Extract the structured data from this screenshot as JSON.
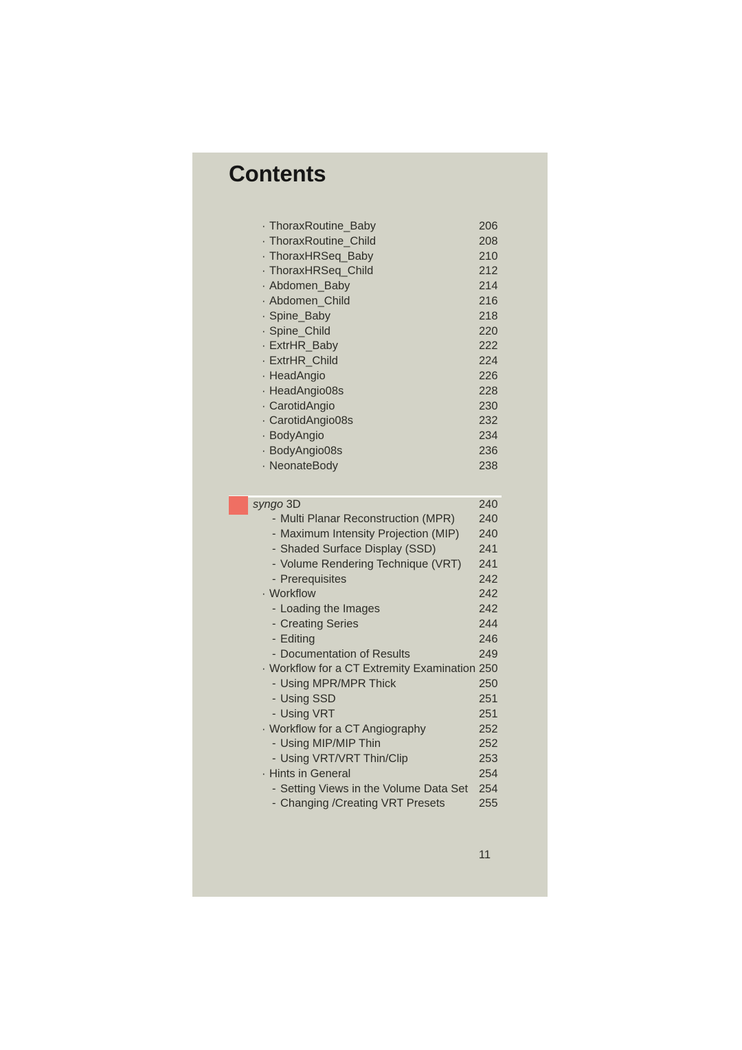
{
  "page": {
    "title": "Contents",
    "folio": "11",
    "panel_color": "#d3d3c7",
    "accent_color": "#ef6f63",
    "text_color": "#2b2b26"
  },
  "entries": [
    {
      "level": 1,
      "marker": "·",
      "label": "ThoraxRoutine_Baby",
      "page": "206"
    },
    {
      "level": 1,
      "marker": "·",
      "label": "ThoraxRoutine_Child",
      "page": "208"
    },
    {
      "level": 1,
      "marker": "·",
      "label": "ThoraxHRSeq_Baby",
      "page": "210"
    },
    {
      "level": 1,
      "marker": "·",
      "label": "ThoraxHRSeq_Child",
      "page": "212"
    },
    {
      "level": 1,
      "marker": "·",
      "label": "Abdomen_Baby",
      "page": "214"
    },
    {
      "level": 1,
      "marker": "·",
      "label": "Abdomen_Child",
      "page": "216"
    },
    {
      "level": 1,
      "marker": "·",
      "label": "Spine_Baby",
      "page": "218"
    },
    {
      "level": 1,
      "marker": "·",
      "label": "Spine_Child",
      "page": "220"
    },
    {
      "level": 1,
      "marker": "·",
      "label": "ExtrHR_Baby",
      "page": "222"
    },
    {
      "level": 1,
      "marker": "·",
      "label": "ExtrHR_Child",
      "page": "224"
    },
    {
      "level": 1,
      "marker": "·",
      "label": "HeadAngio",
      "page": "226"
    },
    {
      "level": 1,
      "marker": "·",
      "label": "HeadAngio08s",
      "page": "228"
    },
    {
      "level": 1,
      "marker": "·",
      "label": "CarotidAngio",
      "page": "230"
    },
    {
      "level": 1,
      "marker": "·",
      "label": "CarotidAngio08s",
      "page": "232"
    },
    {
      "level": 1,
      "marker": "·",
      "label": "BodyAngio",
      "page": "234"
    },
    {
      "level": 1,
      "marker": "·",
      "label": "BodyAngio08s",
      "page": "236"
    },
    {
      "level": 1,
      "marker": "·",
      "label": "NeonateBody",
      "page": "238"
    }
  ],
  "section": {
    "label_italic": "syngo",
    "label_rest": " 3D",
    "page": "240",
    "entries": [
      {
        "level": 2,
        "marker": "-",
        "label": "Multi Planar Reconstruction (MPR)",
        "page": "240"
      },
      {
        "level": 2,
        "marker": "-",
        "label": "Maximum Intensity Projection (MIP)",
        "page": "240"
      },
      {
        "level": 2,
        "marker": "-",
        "label": "Shaded Surface Display (SSD)",
        "page": "241"
      },
      {
        "level": 2,
        "marker": "-",
        "label": "Volume Rendering Technique (VRT)",
        "page": "241"
      },
      {
        "level": 2,
        "marker": "-",
        "label": "Prerequisites",
        "page": "242"
      },
      {
        "level": 1,
        "marker": "·",
        "label": "Workflow",
        "page": "242"
      },
      {
        "level": 2,
        "marker": "-",
        "label": "Loading the Images",
        "page": "242"
      },
      {
        "level": 2,
        "marker": "-",
        "label": "Creating Series",
        "page": "244"
      },
      {
        "level": 2,
        "marker": "-",
        "label": "Editing",
        "page": "246"
      },
      {
        "level": 2,
        "marker": "-",
        "label": "Documentation of Results",
        "page": "249"
      },
      {
        "level": 1,
        "marker": "·",
        "label": "Workflow for a CT Extremity Examination",
        "page": "250"
      },
      {
        "level": 2,
        "marker": "-",
        "label": "Using MPR/MPR Thick",
        "page": "250"
      },
      {
        "level": 2,
        "marker": "-",
        "label": "Using SSD",
        "page": "251"
      },
      {
        "level": 2,
        "marker": "-",
        "label": "Using VRT",
        "page": "251"
      },
      {
        "level": 1,
        "marker": "·",
        "label": "Workflow for a CT Angiography",
        "page": "252"
      },
      {
        "level": 2,
        "marker": "-",
        "label": "Using MIP/MIP Thin",
        "page": "252"
      },
      {
        "level": 2,
        "marker": "-",
        "label": "Using VRT/VRT Thin/Clip",
        "page": "253"
      },
      {
        "level": 1,
        "marker": "·",
        "label": "Hints in General",
        "page": "254"
      },
      {
        "level": 2,
        "marker": "-",
        "label": "Setting Views in the Volume Data Set",
        "page": "254"
      },
      {
        "level": 2,
        "marker": "-",
        "label": "Changing /Creating VRT Presets",
        "page": "255"
      }
    ]
  }
}
